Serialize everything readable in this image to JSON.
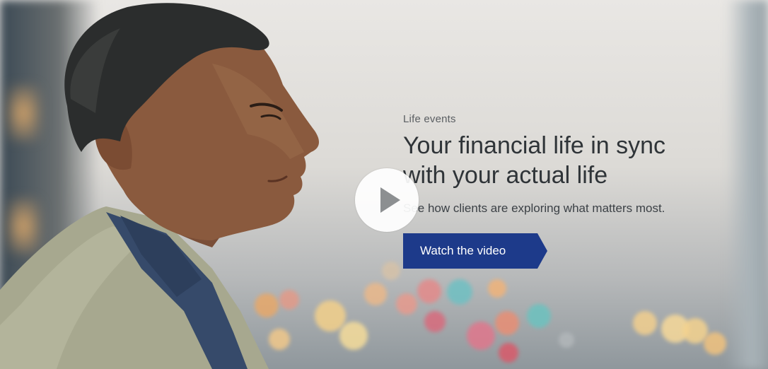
{
  "hero": {
    "eyebrow": "Life events",
    "headline_line1": "Your financial life in sync",
    "headline_line2": "with your actual life",
    "subline": "See how clients are exploring what matters most.",
    "cta_label": "Watch the video",
    "play_icon": "play-icon"
  },
  "colors": {
    "cta_background": "#1d3a8a",
    "play_button_background": "#ffffff",
    "play_icon": "#8c8f91"
  }
}
